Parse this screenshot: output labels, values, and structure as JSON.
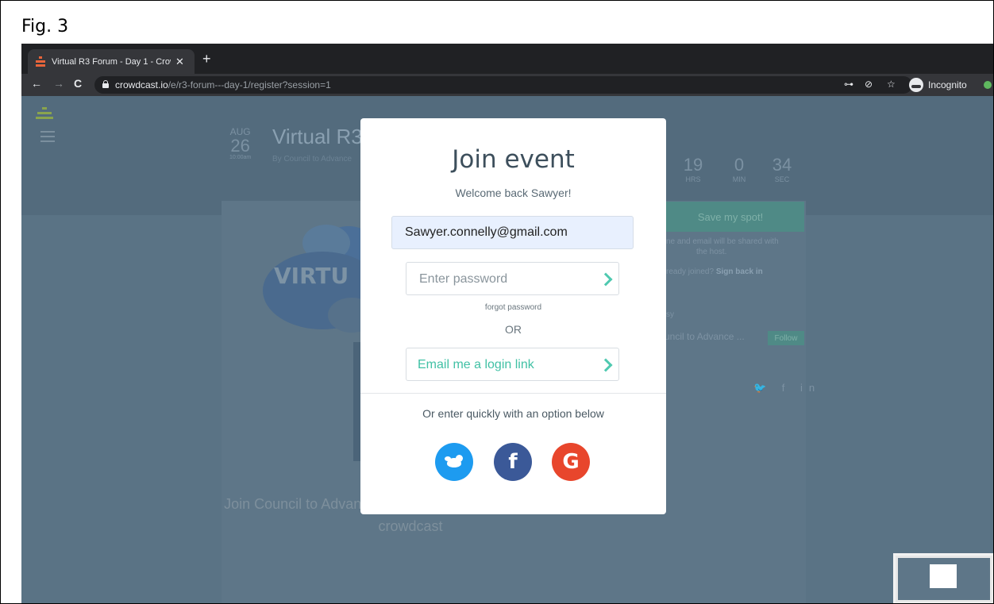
{
  "figure": {
    "label": "Fig. 3"
  },
  "browser": {
    "tab_title": "Virtual R3 Forum - Day 1 - Crowdcast",
    "tab_close": "✕",
    "new_tab": "+",
    "back": "←",
    "forward": "→",
    "reload": "C",
    "url_host": "crowdcast.io",
    "url_path": "/e/r3-forum---day-1/register?session=1",
    "key_icon": "⊶",
    "eye_icon": "⊘",
    "star_icon": "☆",
    "incognito_label": "Incognito"
  },
  "background_page": {
    "date_month": "AUG",
    "date_day": "26",
    "date_time": "10:00am",
    "event_title": "Virtual R3",
    "event_by": "By Council to Advance",
    "countdown": [
      {
        "num": "19",
        "unit": "HRS"
      },
      {
        "num": "0",
        "unit": "MIN"
      },
      {
        "num": "34",
        "unit": "SEC"
      }
    ],
    "save_spot_label": "Save my spot!",
    "privacy_line1": "ne and email will be shared with",
    "privacy_line2": "the host.",
    "already_joined": "ready joined?",
    "sign_back_in": "Sign back in",
    "host_fragment": "sy",
    "host_name": "uncil to Advance ...",
    "follow_label": "Follow",
    "social_row": "🐦 f in",
    "virtual_banner": "VIRTU",
    "join_text": "Join Council to Advance Hunting and the Shooting Sports's crowdcast"
  },
  "modal": {
    "title": "Join event",
    "subtitle": "Welcome back Sawyer!",
    "email_value": "Sawyer.connelly@gmail.com",
    "password_placeholder": "Enter password",
    "forgot_password": "forgot password",
    "or_label": "OR",
    "email_link_label": "Email me a login link",
    "alt_text": "Or enter quickly with an option below",
    "facebook_glyph": "f",
    "google_glyph": "G"
  },
  "colors": {
    "accent_teal": "#41c1a5",
    "twitter": "#1d9bf0",
    "facebook": "#3b5998",
    "google": "#e8462c"
  }
}
